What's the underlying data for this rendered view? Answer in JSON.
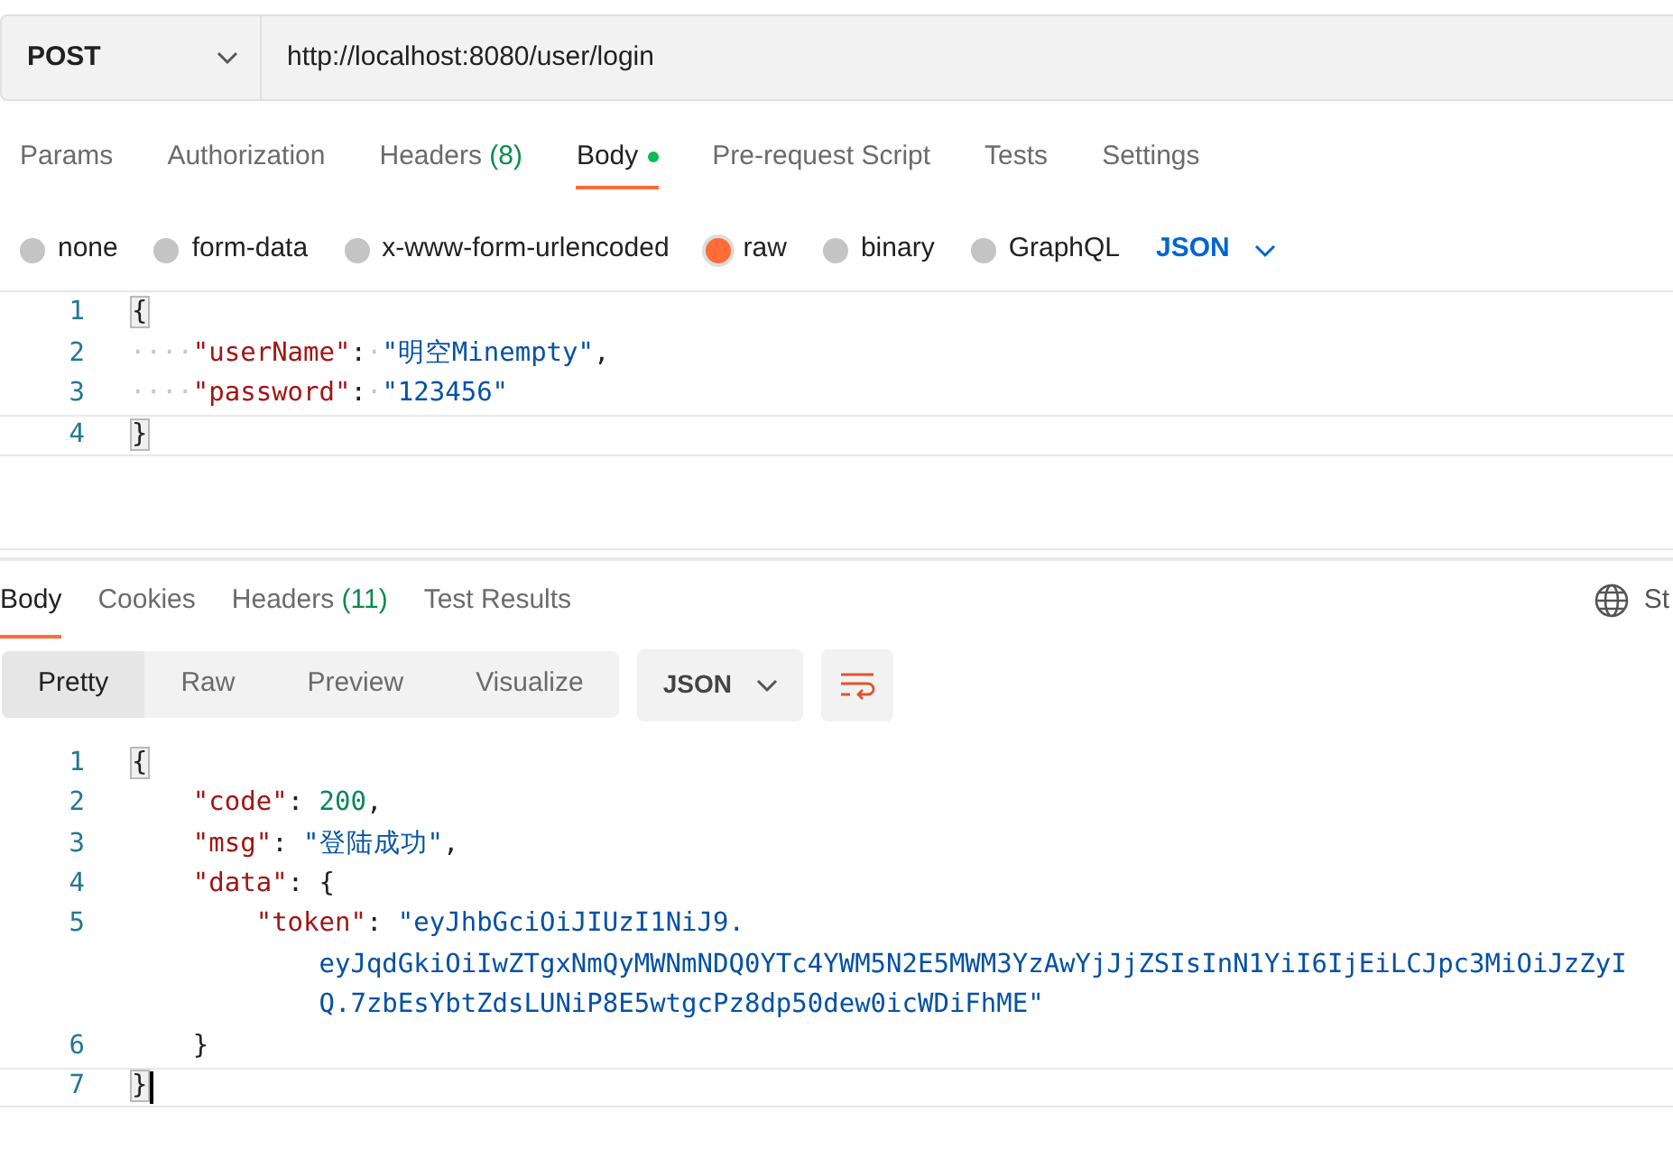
{
  "request": {
    "method": "POST",
    "url": "http://localhost:8080/user/login"
  },
  "request_tabs": [
    {
      "label": "Params",
      "selected": false
    },
    {
      "label": "Authorization",
      "selected": false
    },
    {
      "label": "Headers",
      "count": "(8)",
      "selected": false
    },
    {
      "label": "Body",
      "dot": true,
      "selected": true
    },
    {
      "label": "Pre-request Script",
      "selected": false
    },
    {
      "label": "Tests",
      "selected": false
    },
    {
      "label": "Settings",
      "selected": false
    }
  ],
  "body_types": [
    {
      "label": "none",
      "selected": false
    },
    {
      "label": "form-data",
      "selected": false
    },
    {
      "label": "x-www-form-urlencoded",
      "selected": false
    },
    {
      "label": "raw",
      "selected": true
    },
    {
      "label": "binary",
      "selected": false
    },
    {
      "label": "GraphQL",
      "selected": false
    }
  ],
  "body_language": "JSON",
  "request_body": {
    "lines": [
      {
        "number": "1",
        "current": false,
        "tokens": [
          {
            "kind": "match",
            "text": "{"
          }
        ]
      },
      {
        "number": "2",
        "current": false,
        "tokens": [
          {
            "kind": "ws",
            "text": "····"
          },
          {
            "kind": "key",
            "text": "\"userName\""
          },
          {
            "kind": "punct",
            "text": ":"
          },
          {
            "kind": "ws",
            "text": "·"
          },
          {
            "kind": "string",
            "text": "\"明空Minempty\""
          },
          {
            "kind": "punct",
            "text": ","
          }
        ]
      },
      {
        "number": "3",
        "current": false,
        "tokens": [
          {
            "kind": "ws",
            "text": "····"
          },
          {
            "kind": "key",
            "text": "\"password\""
          },
          {
            "kind": "punct",
            "text": ":"
          },
          {
            "kind": "ws",
            "text": "·"
          },
          {
            "kind": "string",
            "text": "\"123456\""
          }
        ]
      },
      {
        "number": "4",
        "current": true,
        "tokens": [
          {
            "kind": "match",
            "text": "}"
          }
        ]
      }
    ]
  },
  "response_tabs": [
    {
      "label": "Body",
      "selected": true
    },
    {
      "label": "Cookies",
      "selected": false
    },
    {
      "label": "Headers",
      "count": "(11)",
      "selected": false
    },
    {
      "label": "Test Results",
      "selected": false
    }
  ],
  "response_status": "St",
  "view_modes": [
    {
      "label": "Pretty",
      "selected": true
    },
    {
      "label": "Raw",
      "selected": false
    },
    {
      "label": "Preview",
      "selected": false
    },
    {
      "label": "Visualize",
      "selected": false
    }
  ],
  "response_format": "JSON",
  "response_body": {
    "lines": [
      {
        "number": "1",
        "current": false,
        "tokens": [
          {
            "kind": "match",
            "text": "{"
          }
        ]
      },
      {
        "number": "2",
        "current": false,
        "tokens": [
          {
            "kind": "key",
            "text": "    \"code\""
          },
          {
            "kind": "punct",
            "text": ": "
          },
          {
            "kind": "number",
            "text": "200"
          },
          {
            "kind": "punct",
            "text": ","
          }
        ]
      },
      {
        "number": "3",
        "current": false,
        "tokens": [
          {
            "kind": "key",
            "text": "    \"msg\""
          },
          {
            "kind": "punct",
            "text": ": "
          },
          {
            "kind": "string",
            "text": "\"登陆成功\""
          },
          {
            "kind": "punct",
            "text": ","
          }
        ]
      },
      {
        "number": "4",
        "current": false,
        "tokens": [
          {
            "kind": "key",
            "text": "    \"data\""
          },
          {
            "kind": "punct",
            "text": ": {"
          }
        ]
      },
      {
        "number": "5",
        "current": false,
        "tokens": [
          {
            "kind": "key",
            "text": "        \"token\""
          },
          {
            "kind": "punct",
            "text": ": "
          },
          {
            "kind": "string",
            "text": "\"eyJhbGciOiJIUzI1NiJ9."
          }
        ]
      },
      {
        "current": false,
        "tokens": [
          {
            "kind": "string",
            "text": "            eyJqdGkiOiIwZTgxNmQyMWNmNDQ0YTc4YWM5N2E5MWM3YzAwYjJjZSIsInN1YiI6IjEiLCJpc3MiOiJzZyI"
          }
        ]
      },
      {
        "current": false,
        "tokens": [
          {
            "kind": "string",
            "text": "            Q.7zbEsYbtZdsLUNiP8E5wtgcPz8dp50dew0icWDiFhME\""
          }
        ]
      },
      {
        "number": "6",
        "current": false,
        "tokens": [
          {
            "kind": "punct",
            "text": "    }"
          }
        ]
      },
      {
        "number": "7",
        "current": true,
        "tokens": [
          {
            "kind": "match",
            "text": "}"
          }
        ]
      }
    ]
  }
}
